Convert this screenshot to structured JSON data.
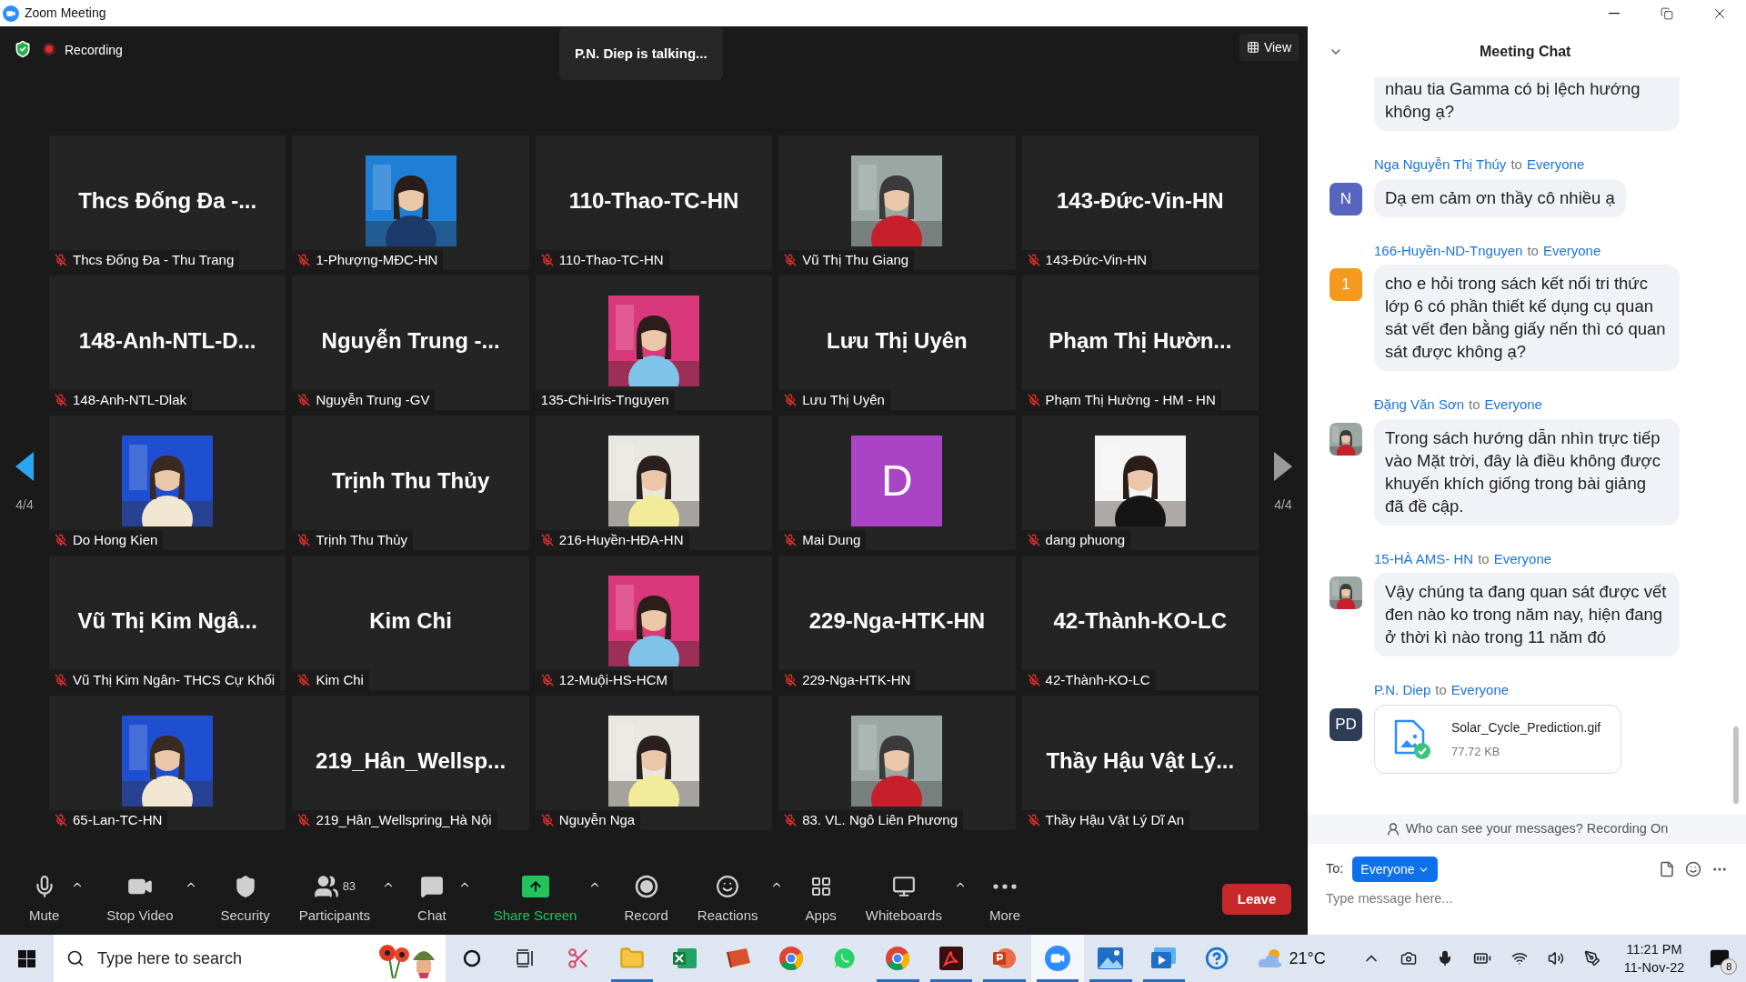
{
  "window": {
    "title": "Zoom Meeting"
  },
  "meeting_bar": {
    "recording_label": "Recording",
    "speaker": "P.N. Diep is talking...",
    "view_button": "View"
  },
  "pager": {
    "prev": {
      "label": "4/4",
      "disabled": false
    },
    "next": {
      "label": "4/4",
      "disabled": true
    }
  },
  "tiles": [
    {
      "kind": "name",
      "display": "Thcs Đống Đa -...",
      "name": "Thcs Đống Đa - Thu Trang",
      "muted": true
    },
    {
      "kind": "picture",
      "name": "1-Phượng-MĐC-HN",
      "muted": true
    },
    {
      "kind": "name",
      "display": "110-Thao-TC-HN",
      "name": "110-Thao-TC-HN",
      "muted": true
    },
    {
      "kind": "picture",
      "name": "Vũ Thị Thu Giang",
      "muted": true
    },
    {
      "kind": "name",
      "display": "143-Đức-Vin-HN",
      "name": "143-Đức-Vin-HN",
      "muted": true
    },
    {
      "kind": "name",
      "display": "148-Anh-NTL-D...",
      "name": "148-Anh-NTL-Dlak",
      "muted": true
    },
    {
      "kind": "name",
      "display": "Nguyễn Trung -...",
      "name": "Nguyễn Trung -GV",
      "muted": true
    },
    {
      "kind": "picture",
      "name": "135-Chi-Iris-Tnguyen",
      "muted": false
    },
    {
      "kind": "name",
      "display": "Lưu Thị Uyên",
      "name": "Lưu Thị Uyên",
      "muted": true
    },
    {
      "kind": "name",
      "display": "Phạm Thị Hườn...",
      "name": "Phạm Thị Hường - HM - HN",
      "muted": true
    },
    {
      "kind": "picture",
      "name": "Do Hong Kien",
      "muted": true
    },
    {
      "kind": "name",
      "display": "Trịnh Thu Thủy",
      "name": "Trịnh Thu Thủy",
      "muted": true
    },
    {
      "kind": "picture",
      "name": "216-Huyền-HĐA-HN",
      "muted": true
    },
    {
      "kind": "letter",
      "letter": "D",
      "name": "Mai Dung",
      "muted": true
    },
    {
      "kind": "picture",
      "name": "dang phuong",
      "muted": true
    },
    {
      "kind": "name",
      "display": "Vũ Thị Kim Ngâ...",
      "name": "Vũ Thị Kim Ngân- THCS Cự Khối",
      "muted": true
    },
    {
      "kind": "name",
      "display": "Kim Chi",
      "name": "Kim Chi",
      "muted": true
    },
    {
      "kind": "picture",
      "name": "12-Muội-HS-HCM",
      "muted": true
    },
    {
      "kind": "name",
      "display": "229-Nga-HTK-HN",
      "name": "229-Nga-HTK-HN",
      "muted": true
    },
    {
      "kind": "name",
      "display": "42-Thành-KO-LC",
      "name": "42-Thành-KO-LC",
      "muted": true
    },
    {
      "kind": "picture",
      "name": "65-Lan-TC-HN",
      "muted": true
    },
    {
      "kind": "name",
      "display": "219_Hân_Wellsp...",
      "name": "219_Hân_Wellspring_Hà Nội",
      "muted": true
    },
    {
      "kind": "picture",
      "name": "Nguyễn Nga",
      "muted": true
    },
    {
      "kind": "picture",
      "name": "83. VL. Ngô Liên Phương",
      "muted": true
    },
    {
      "kind": "name",
      "display": "Thầy Hậu Vật Lý...",
      "name": "Thầy Hậu Vật Lý Dĩ An",
      "muted": true
    }
  ],
  "toolbar": {
    "items": [
      {
        "kind": "mute",
        "label": "Mute",
        "menu": true
      },
      {
        "kind": "video",
        "label": "Stop Video",
        "menu": true
      },
      {
        "kind": "security",
        "label": "Security",
        "menu": false
      },
      {
        "kind": "participants",
        "label": "Participants",
        "count": "83",
        "menu": true
      },
      {
        "kind": "chat",
        "label": "Chat",
        "menu": true
      },
      {
        "kind": "share",
        "label": "Share Screen",
        "menu": true
      },
      {
        "kind": "record",
        "label": "Record",
        "menu": false
      },
      {
        "kind": "reactions",
        "label": "Reactions",
        "menu": true
      },
      {
        "kind": "apps",
        "label": "Apps",
        "menu": false
      },
      {
        "kind": "whiteboards",
        "label": "Whiteboards",
        "menu": true
      },
      {
        "kind": "more",
        "label": "More",
        "menu": false
      }
    ],
    "leave": "Leave"
  },
  "chat": {
    "title": "Meeting Chat",
    "messages": [
      {
        "kind": "text",
        "text": "nhau tia Gamma có bị lệch hướng không ạ?"
      },
      {
        "sender": "Nga Nguyễn Thị Thúy",
        "to": "to",
        "recipient": "Everyone",
        "avatar": {
          "kind": "letter",
          "letter": "N",
          "color": "#5865c0"
        },
        "kind": "text",
        "text": "Dạ em cảm ơn thầy cô nhiều ạ"
      },
      {
        "sender": "166-Huyền-ND-Tnguyen",
        "to": "to",
        "recipient": "Everyone",
        "avatar": {
          "kind": "letter",
          "letter": "1",
          "color": "#f39a1e"
        },
        "kind": "text",
        "text": "cho e hỏi trong sách kết nối tri thức lớp 6 có phần thiết kế dụng cụ quan sát vết đen bằng giấy nến thì có quan sát được không ạ?"
      },
      {
        "sender": "Đặng Văn Sơn",
        "to": "to",
        "recipient": "Everyone",
        "kind": "text",
        "text": "Trong sách hướng dẫn nhìn trực tiếp vào Mặt trời, đây là điều không được khuyến khích giống trong bài giảng đã đề cập."
      },
      {
        "sender": "15-HÀ AMS- HN",
        "to": "to",
        "recipient": "Everyone",
        "kind": "text",
        "text": "Vậy chúng ta đang quan sát được vết đen nào ko trong năm nay, hiện đang ở thời kì nào trong 11 năm đó"
      },
      {
        "sender": "P.N. Diep",
        "to": "to",
        "recipient": "Everyone",
        "avatar": {
          "kind": "letter",
          "letter": "PD",
          "color": "#2d3d55"
        },
        "kind": "file",
        "file_name": "Solar_Cycle_Prediction.gif",
        "file_size": "77.72 KB"
      }
    ],
    "notice": "Who can see your messages? Recording On",
    "to_label": "To:",
    "recipient": "Everyone",
    "placeholder": "Type message here..."
  },
  "taskbar": {
    "search_placeholder": "Type here to search",
    "apps": [
      {
        "kind": "cortana",
        "running": false,
        "active": false
      },
      {
        "kind": "taskview",
        "running": false,
        "active": false
      },
      {
        "kind": "snipping",
        "running": false,
        "active": false
      },
      {
        "kind": "explorer",
        "running": true,
        "active": false
      },
      {
        "kind": "excel",
        "running": false,
        "active": false
      },
      {
        "kind": "book",
        "running": false,
        "active": false
      },
      {
        "kind": "chrome",
        "running": false,
        "active": false
      },
      {
        "kind": "whatsapp",
        "running": false,
        "active": false
      },
      {
        "kind": "chrome",
        "running": true,
        "active": false
      },
      {
        "kind": "acrobat",
        "running": true,
        "active": false
      },
      {
        "kind": "powerpoint",
        "running": true,
        "active": false
      },
      {
        "kind": "zoom",
        "running": true,
        "active": true
      },
      {
        "kind": "photos",
        "running": true,
        "active": false
      },
      {
        "kind": "media",
        "running": true,
        "active": false
      },
      {
        "kind": "help",
        "running": false,
        "active": false
      }
    ],
    "weather": "21°C",
    "time": "11:21 PM",
    "date": "11-Nov-22",
    "notifications": "8"
  }
}
